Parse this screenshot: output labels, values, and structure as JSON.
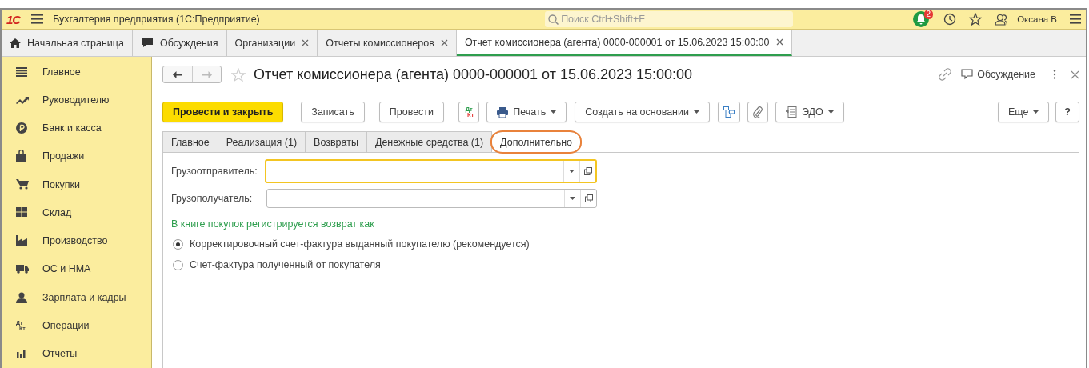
{
  "app": {
    "logo": "1С",
    "title": "Бухгалтерия предприятия  (1С:Предприятие)",
    "search": {
      "placeholder": "Поиск Ctrl+Shift+F"
    },
    "notifications": "2",
    "user": "Оксана В"
  },
  "open_tabs": [
    {
      "label": "Начальная страница",
      "closable": false,
      "selected": false
    },
    {
      "label": "Обсуждения",
      "closable": false,
      "selected": false
    },
    {
      "label": "Организации",
      "closable": true,
      "selected": false
    },
    {
      "label": "Отчеты комиссионеров",
      "closable": true,
      "selected": false
    },
    {
      "label": "Отчет комиссионера (агента) 0000-000001 от 15.06.2023 15:00:00",
      "closable": true,
      "selected": true
    }
  ],
  "sidebar": {
    "items": [
      {
        "label": "Главное"
      },
      {
        "label": "Руководителю"
      },
      {
        "label": "Банк и касса"
      },
      {
        "label": "Продажи"
      },
      {
        "label": "Покупки"
      },
      {
        "label": "Склад"
      },
      {
        "label": "Производство"
      },
      {
        "label": "ОС и НМА"
      },
      {
        "label": "Зарплата и кадры"
      },
      {
        "label": "Операции",
        "icon_text": [
          "Дт",
          "Кт"
        ]
      },
      {
        "label": "Отчеты"
      }
    ]
  },
  "document": {
    "title": "Отчет комиссионера (агента) 0000-000001 от 15.06.2023 15:00:00",
    "discussion": "Обсуждение",
    "toolbar": [
      {
        "kind": "primary",
        "label": "Провести и закрыть"
      },
      {
        "kind": "button",
        "label": "Записать"
      },
      {
        "kind": "button",
        "label": "Провести"
      },
      {
        "kind": "dtkt",
        "top": "Дт",
        "bottom": "Кт"
      },
      {
        "kind": "dropdown",
        "label": "Печать"
      },
      {
        "kind": "dropdown",
        "label": "Создать на основании"
      },
      {
        "kind": "icon"
      },
      {
        "kind": "icon"
      },
      {
        "kind": "dropdown",
        "label": "ЭДО"
      }
    ],
    "more": "Еще",
    "help": "?",
    "tabs": [
      {
        "label": "Главное",
        "selected": false,
        "circled": false
      },
      {
        "label": "Реализация (1)",
        "selected": false,
        "circled": false
      },
      {
        "label": "Возвраты",
        "selected": false,
        "circled": false
      },
      {
        "label": "Денежные средства (1)",
        "selected": false,
        "circled": false
      },
      {
        "label": "Дополнительно",
        "selected": true,
        "circled": true
      }
    ],
    "fields": [
      {
        "label": "Грузоотправитель:",
        "focused": true
      },
      {
        "label": "Грузополучатель:",
        "focused": false
      }
    ],
    "section_label": "В книге покупок регистрируется возврат как",
    "options": [
      {
        "label": "Корректировочный счет-фактура выданный покупателю (рекомендуется)",
        "selected": true
      },
      {
        "label": "Счет-фактура полученный от покупателя",
        "selected": false
      }
    ]
  }
}
